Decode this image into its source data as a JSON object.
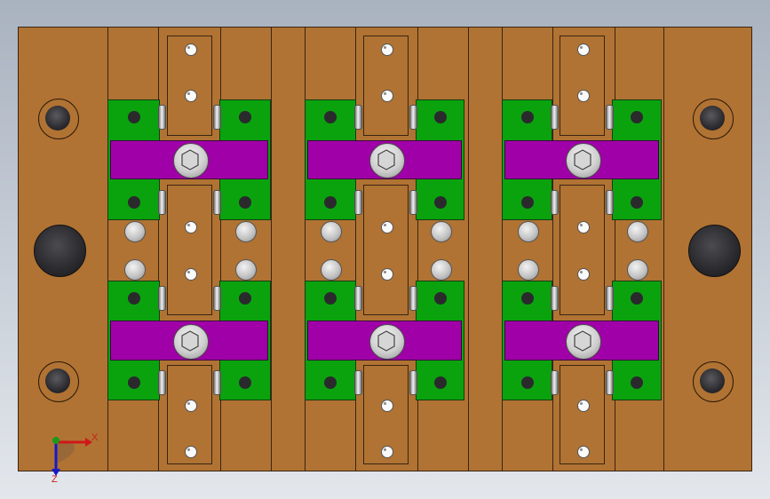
{
  "viewport": {
    "background_colors": [
      "#a9b2bf",
      "#e3e7ec"
    ]
  },
  "model": {
    "plate_color": "#b07333",
    "locator_color": "#0aa30e",
    "clamp_color": "#a000a8",
    "fixture_count": 3,
    "clamp_rows_per_fixture": 2
  },
  "triad": {
    "x_label": "X",
    "z_label": "Z",
    "x_color": "#d01818",
    "y_color": "#1a9a1a",
    "z_color": "#1818c8"
  }
}
